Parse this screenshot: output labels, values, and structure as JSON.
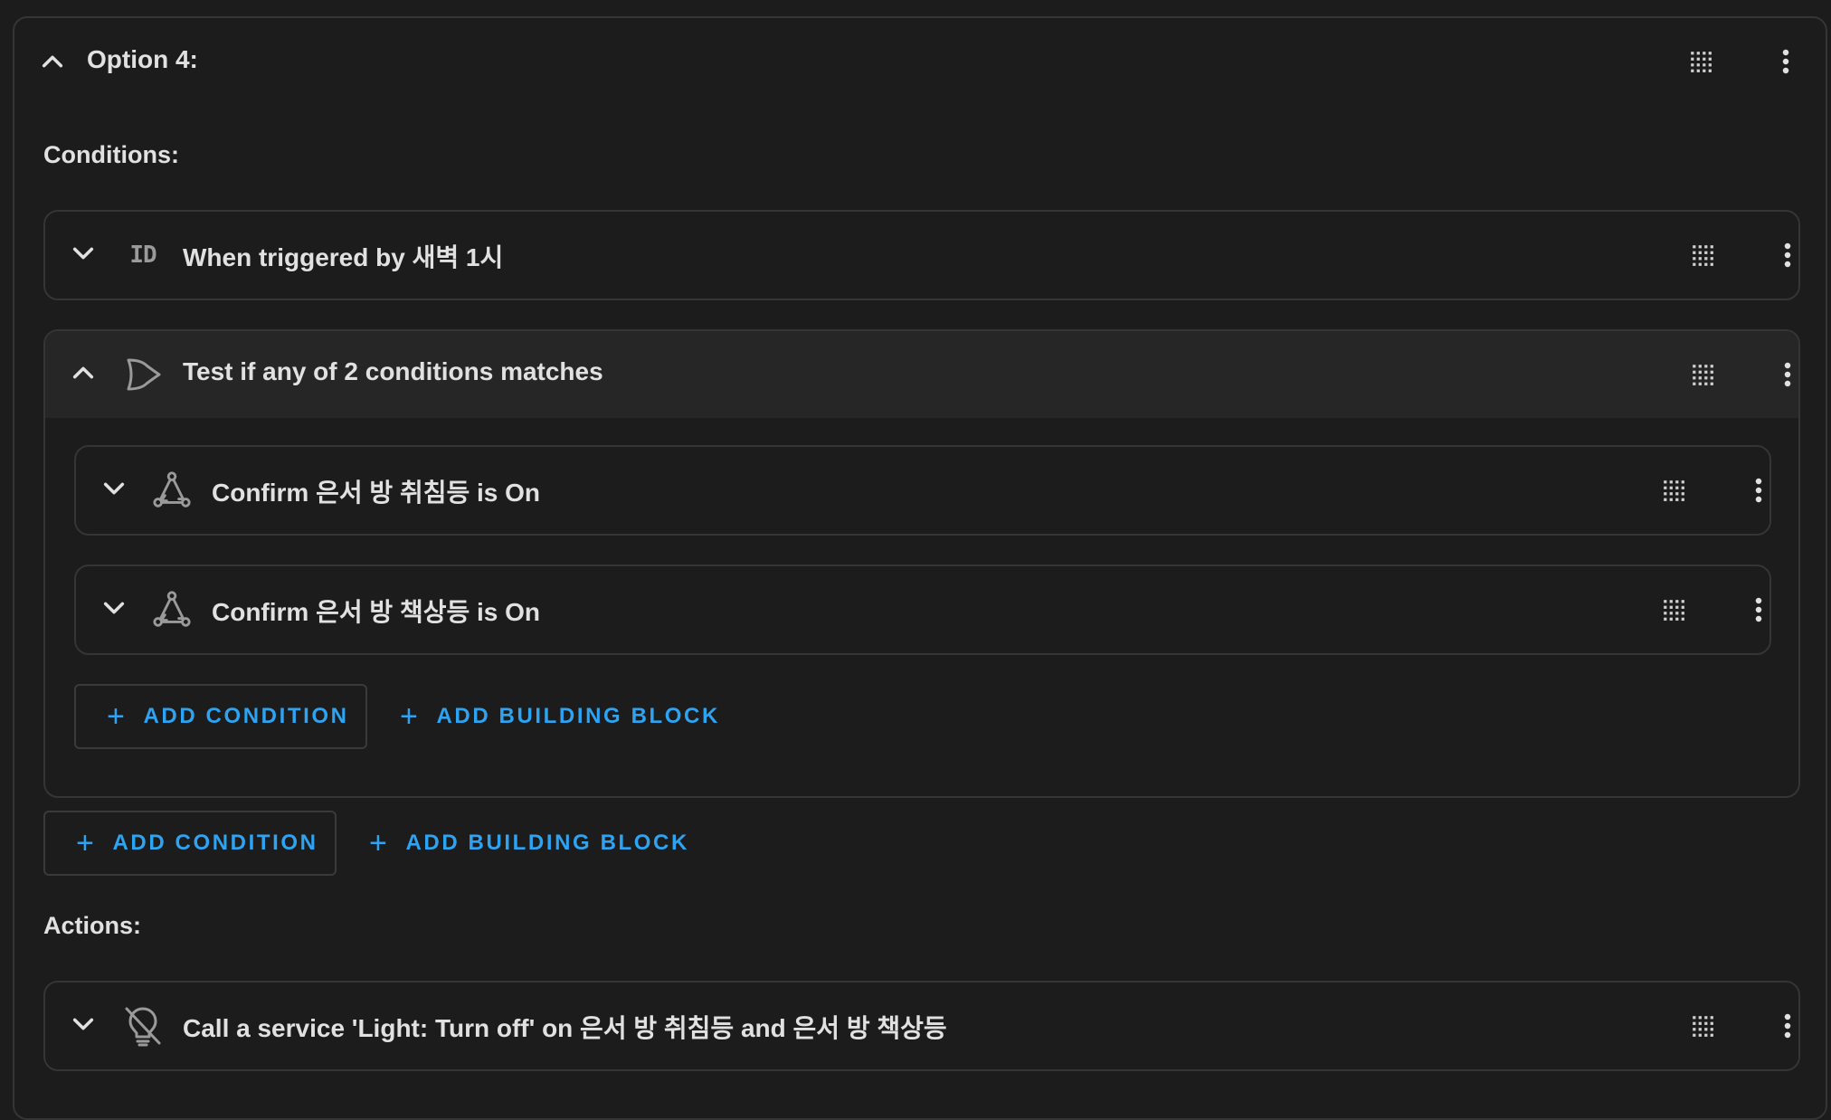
{
  "option": {
    "title": "Option 4:"
  },
  "sections": {
    "conditions_label": "Conditions:",
    "actions_label": "Actions:"
  },
  "conditions": {
    "trigger_card": {
      "icon": "id-icon",
      "title": "When triggered by 새벽 1시"
    },
    "or_card": {
      "icon": "or-gate-icon",
      "title": "Test if any of 2 conditions matches",
      "children": [
        {
          "icon": "state-icon",
          "title": "Confirm 은서 방 취침등 is On"
        },
        {
          "icon": "state-icon",
          "title": "Confirm 은서 방 책상등 is On"
        }
      ],
      "add_condition_label": "ADD CONDITION",
      "add_building_block_label": "ADD BUILDING BLOCK"
    },
    "add_condition_label": "ADD CONDITION",
    "add_building_block_label": "ADD BUILDING BLOCK"
  },
  "actions": {
    "service_card": {
      "icon": "lightbulb-off-icon",
      "title": "Call a service 'Light: Turn off' on 은서 방 취침등 and 은서 방 책상등"
    }
  },
  "colors": {
    "background": "#1c1c1c",
    "border": "#353535",
    "accent": "#2ea3f2",
    "header_highlight": "#262626",
    "text": "#e1e1e1"
  }
}
